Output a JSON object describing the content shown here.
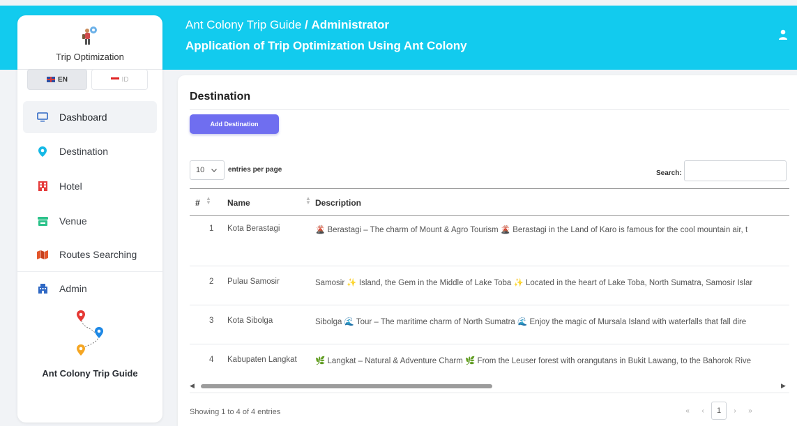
{
  "header": {
    "app_name": "Ant Colony Trip Guide",
    "separator": "/",
    "role": "Administrator",
    "subtitle": "Application of Trip Optimization Using Ant Colony"
  },
  "sidebar": {
    "brand": "Trip Optimization",
    "languages": [
      {
        "code": "EN",
        "icon": "uk-flag-icon",
        "active": true
      },
      {
        "code": "ID",
        "icon": "id-flag-icon",
        "active": false
      }
    ],
    "items": [
      {
        "label": "Dashboard",
        "icon": "monitor-icon",
        "active": true
      },
      {
        "label": "Destination",
        "icon": "location-pin-icon"
      },
      {
        "label": "Hotel",
        "icon": "hotel-icon"
      },
      {
        "label": "Venue",
        "icon": "store-icon"
      },
      {
        "label": "Routes Searching",
        "icon": "map-icon"
      },
      {
        "label": "Admin",
        "icon": "admin-icon"
      }
    ],
    "footer_brand": "Ant Colony Trip Guide"
  },
  "main": {
    "title": "Destination",
    "add_button": "Add Destination",
    "per_page_value": "10",
    "per_page_label": "entries per page",
    "search_label": "Search:",
    "search_value": "",
    "columns": [
      "#",
      "Name",
      "Description"
    ],
    "rows": [
      {
        "num": "1",
        "name": "Kota Berastagi",
        "description": "🌋 Berastagi – The charm of Mount & Agro Tourism 🌋 Berastagi in the Land of Karo is famous for the cool mountain air, t"
      },
      {
        "num": "2",
        "name": "Pulau Samosir",
        "description": "Samosir ✨ Island, the Gem in the Middle of Lake Toba ✨ Located in the heart of Lake Toba, North Sumatra, Samosir Islar"
      },
      {
        "num": "3",
        "name": "Kota Sibolga",
        "description": "Sibolga 🌊 Tour – The maritime charm of North Sumatra 🌊 Enjoy the magic of Mursala Island with waterfalls that fall dire"
      },
      {
        "num": "4",
        "name": "Kabupaten Langkat",
        "description": "🌿 Langkat – Natural & Adventure Charm 🌿 From the Leuser forest with orangutans in Bukit Lawang, to the Bahorok Rive"
      }
    ],
    "showing": "Showing 1 to 4 of 4 entries",
    "pager": {
      "first": "«",
      "prev": "‹",
      "current": "1",
      "next": "›",
      "last": "»"
    }
  },
  "colors": {
    "header_bg": "#12cbee",
    "button_bg": "#6f6ef0",
    "pin_red": "#e53935",
    "pin_blue": "#1e88e5",
    "pin_orange": "#f5a623"
  }
}
